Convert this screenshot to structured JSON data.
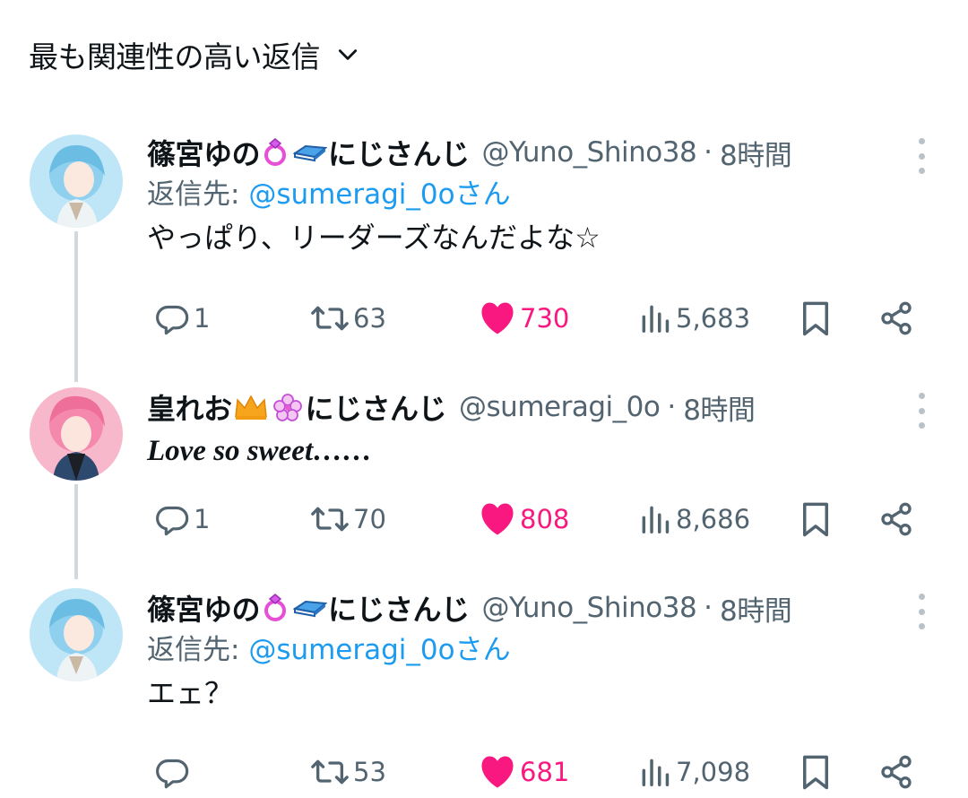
{
  "header": {
    "sort_label": "最も関連性の高い返信",
    "chevron_icon": "chevron-down-icon"
  },
  "colors": {
    "like": "#f91880",
    "link": "#1d9bf0",
    "muted": "#536471",
    "thread_line": "#cfd9de"
  },
  "tweets": [
    {
      "display_name": "篠宮ゆの",
      "emojis": [
        "ring-emoji",
        "book-emoji"
      ],
      "name_suffix": "にじさんじ",
      "handle": "@Yuno_Shino38",
      "separator": "·",
      "time": "8時間",
      "reply_to_prefix": "返信先: ",
      "reply_to_mention": "@sumeragi_0oさん",
      "text": "やっぱり、リーダーズなんだよな☆",
      "replies": "1",
      "retweets": "63",
      "likes": "730",
      "views": "5,683"
    },
    {
      "display_name": "皇れお",
      "emojis": [
        "crown-emoji",
        "flower-emoji"
      ],
      "name_suffix": "にじさんじ",
      "handle": "@sumeragi_0o",
      "separator": "·",
      "time": "8時間",
      "text": "Love so sweet……",
      "replies": "1",
      "retweets": "70",
      "likes": "808",
      "views": "8,686"
    },
    {
      "display_name": "篠宮ゆの",
      "emojis": [
        "ring-emoji",
        "book-emoji"
      ],
      "name_suffix": "にじさんじ",
      "handle": "@Yuno_Shino38",
      "separator": "·",
      "time": "8時間",
      "reply_to_prefix": "返信先: ",
      "reply_to_mention": "@sumeragi_0oさん",
      "text": "エェ？",
      "replies": "",
      "retweets": "53",
      "likes": "681",
      "views": "7,098"
    }
  ]
}
